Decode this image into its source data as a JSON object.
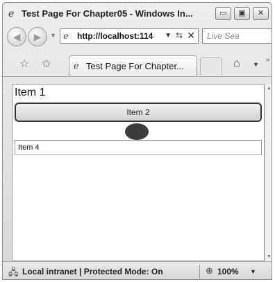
{
  "window": {
    "title": "Test Page For Chapter05 - Windows In...",
    "title_icon": "ie-icon",
    "minimize": "▭",
    "maximize": "▣",
    "close": "✕"
  },
  "navbar": {
    "back": "◀",
    "forward": "▶",
    "address": "http://localhost:114",
    "search_placeholder": "Live Sea"
  },
  "tabs": {
    "active_label": "Test Page For Chapter..."
  },
  "content": {
    "items": [
      "Item 1",
      "Item 2",
      "Item 4"
    ]
  },
  "statusbar": {
    "zone": "Local intranet | Protected Mode: On",
    "zoom": "100%"
  }
}
